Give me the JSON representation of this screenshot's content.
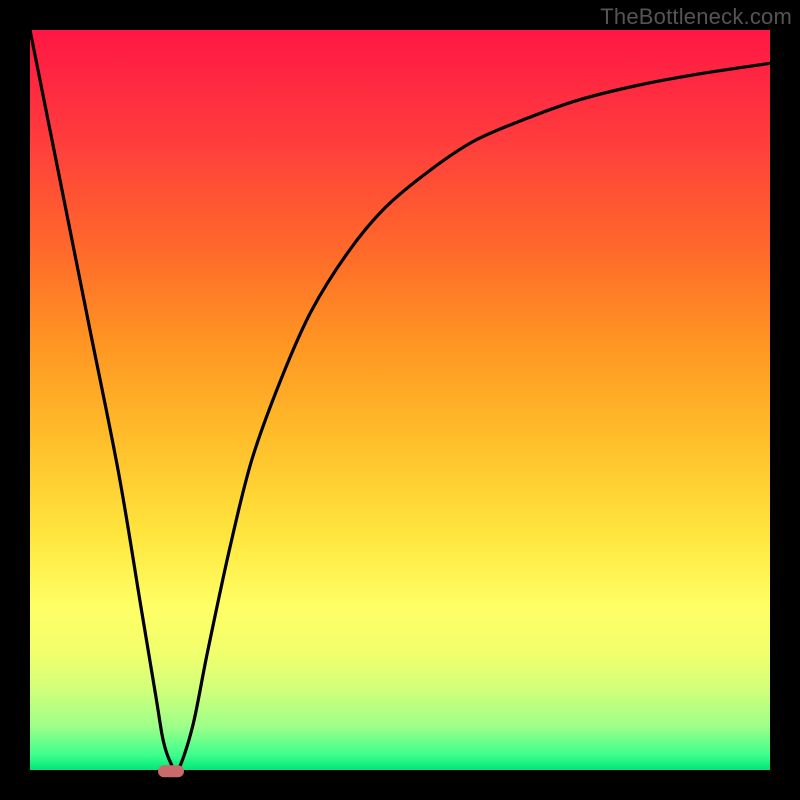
{
  "watermark": "TheBottleneck.com",
  "chart_data": {
    "type": "line",
    "title": "",
    "xlabel": "",
    "ylabel": "",
    "xlim": [
      0,
      100
    ],
    "ylim": [
      0,
      100
    ],
    "series": [
      {
        "name": "curve",
        "x": [
          0,
          4,
          8,
          12,
          15,
          17,
          18,
          19,
          20,
          22,
          24,
          27,
          30,
          34,
          38,
          43,
          48,
          54,
          60,
          67,
          74,
          82,
          90,
          100
        ],
        "y": [
          100,
          80,
          60,
          40,
          22,
          10,
          4,
          1,
          0,
          6,
          16,
          30,
          42,
          53,
          62,
          70,
          76,
          81,
          85,
          88,
          90.5,
          92.5,
          94,
          95.5
        ]
      }
    ],
    "marker": {
      "x": 19,
      "y": 0,
      "color": "#c96b6b"
    },
    "gradient_stops": [
      {
        "pos": 0.0,
        "color": "#ff1744"
      },
      {
        "pos": 0.14,
        "color": "#ff3a3e"
      },
      {
        "pos": 0.3,
        "color": "#ff6a2a"
      },
      {
        "pos": 0.42,
        "color": "#ff9422"
      },
      {
        "pos": 0.55,
        "color": "#ffbd2a"
      },
      {
        "pos": 0.68,
        "color": "#ffe53d"
      },
      {
        "pos": 0.78,
        "color": "#ffff66"
      },
      {
        "pos": 0.84,
        "color": "#f2ff6c"
      },
      {
        "pos": 0.89,
        "color": "#d2ff7a"
      },
      {
        "pos": 0.94,
        "color": "#9fff88"
      },
      {
        "pos": 0.98,
        "color": "#3cff8d"
      },
      {
        "pos": 1.0,
        "color": "#00e676"
      }
    ]
  }
}
